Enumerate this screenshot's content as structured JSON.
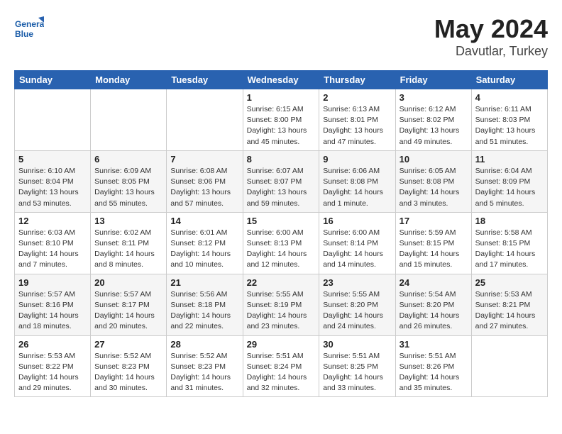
{
  "logo": {
    "line1": "General",
    "line2": "Blue"
  },
  "title": "May 2024",
  "location": "Davutlar, Turkey",
  "weekdays": [
    "Sunday",
    "Monday",
    "Tuesday",
    "Wednesday",
    "Thursday",
    "Friday",
    "Saturday"
  ],
  "weeks": [
    [
      {
        "day": "",
        "info": ""
      },
      {
        "day": "",
        "info": ""
      },
      {
        "day": "",
        "info": ""
      },
      {
        "day": "1",
        "info": "Sunrise: 6:15 AM\nSunset: 8:00 PM\nDaylight: 13 hours\nand 45 minutes."
      },
      {
        "day": "2",
        "info": "Sunrise: 6:13 AM\nSunset: 8:01 PM\nDaylight: 13 hours\nand 47 minutes."
      },
      {
        "day": "3",
        "info": "Sunrise: 6:12 AM\nSunset: 8:02 PM\nDaylight: 13 hours\nand 49 minutes."
      },
      {
        "day": "4",
        "info": "Sunrise: 6:11 AM\nSunset: 8:03 PM\nDaylight: 13 hours\nand 51 minutes."
      }
    ],
    [
      {
        "day": "5",
        "info": "Sunrise: 6:10 AM\nSunset: 8:04 PM\nDaylight: 13 hours\nand 53 minutes."
      },
      {
        "day": "6",
        "info": "Sunrise: 6:09 AM\nSunset: 8:05 PM\nDaylight: 13 hours\nand 55 minutes."
      },
      {
        "day": "7",
        "info": "Sunrise: 6:08 AM\nSunset: 8:06 PM\nDaylight: 13 hours\nand 57 minutes."
      },
      {
        "day": "8",
        "info": "Sunrise: 6:07 AM\nSunset: 8:07 PM\nDaylight: 13 hours\nand 59 minutes."
      },
      {
        "day": "9",
        "info": "Sunrise: 6:06 AM\nSunset: 8:08 PM\nDaylight: 14 hours\nand 1 minute."
      },
      {
        "day": "10",
        "info": "Sunrise: 6:05 AM\nSunset: 8:08 PM\nDaylight: 14 hours\nand 3 minutes."
      },
      {
        "day": "11",
        "info": "Sunrise: 6:04 AM\nSunset: 8:09 PM\nDaylight: 14 hours\nand 5 minutes."
      }
    ],
    [
      {
        "day": "12",
        "info": "Sunrise: 6:03 AM\nSunset: 8:10 PM\nDaylight: 14 hours\nand 7 minutes."
      },
      {
        "day": "13",
        "info": "Sunrise: 6:02 AM\nSunset: 8:11 PM\nDaylight: 14 hours\nand 8 minutes."
      },
      {
        "day": "14",
        "info": "Sunrise: 6:01 AM\nSunset: 8:12 PM\nDaylight: 14 hours\nand 10 minutes."
      },
      {
        "day": "15",
        "info": "Sunrise: 6:00 AM\nSunset: 8:13 PM\nDaylight: 14 hours\nand 12 minutes."
      },
      {
        "day": "16",
        "info": "Sunrise: 6:00 AM\nSunset: 8:14 PM\nDaylight: 14 hours\nand 14 minutes."
      },
      {
        "day": "17",
        "info": "Sunrise: 5:59 AM\nSunset: 8:15 PM\nDaylight: 14 hours\nand 15 minutes."
      },
      {
        "day": "18",
        "info": "Sunrise: 5:58 AM\nSunset: 8:15 PM\nDaylight: 14 hours\nand 17 minutes."
      }
    ],
    [
      {
        "day": "19",
        "info": "Sunrise: 5:57 AM\nSunset: 8:16 PM\nDaylight: 14 hours\nand 18 minutes."
      },
      {
        "day": "20",
        "info": "Sunrise: 5:57 AM\nSunset: 8:17 PM\nDaylight: 14 hours\nand 20 minutes."
      },
      {
        "day": "21",
        "info": "Sunrise: 5:56 AM\nSunset: 8:18 PM\nDaylight: 14 hours\nand 22 minutes."
      },
      {
        "day": "22",
        "info": "Sunrise: 5:55 AM\nSunset: 8:19 PM\nDaylight: 14 hours\nand 23 minutes."
      },
      {
        "day": "23",
        "info": "Sunrise: 5:55 AM\nSunset: 8:20 PM\nDaylight: 14 hours\nand 24 minutes."
      },
      {
        "day": "24",
        "info": "Sunrise: 5:54 AM\nSunset: 8:20 PM\nDaylight: 14 hours\nand 26 minutes."
      },
      {
        "day": "25",
        "info": "Sunrise: 5:53 AM\nSunset: 8:21 PM\nDaylight: 14 hours\nand 27 minutes."
      }
    ],
    [
      {
        "day": "26",
        "info": "Sunrise: 5:53 AM\nSunset: 8:22 PM\nDaylight: 14 hours\nand 29 minutes."
      },
      {
        "day": "27",
        "info": "Sunrise: 5:52 AM\nSunset: 8:23 PM\nDaylight: 14 hours\nand 30 minutes."
      },
      {
        "day": "28",
        "info": "Sunrise: 5:52 AM\nSunset: 8:23 PM\nDaylight: 14 hours\nand 31 minutes."
      },
      {
        "day": "29",
        "info": "Sunrise: 5:51 AM\nSunset: 8:24 PM\nDaylight: 14 hours\nand 32 minutes."
      },
      {
        "day": "30",
        "info": "Sunrise: 5:51 AM\nSunset: 8:25 PM\nDaylight: 14 hours\nand 33 minutes."
      },
      {
        "day": "31",
        "info": "Sunrise: 5:51 AM\nSunset: 8:26 PM\nDaylight: 14 hours\nand 35 minutes."
      },
      {
        "day": "",
        "info": ""
      }
    ]
  ]
}
